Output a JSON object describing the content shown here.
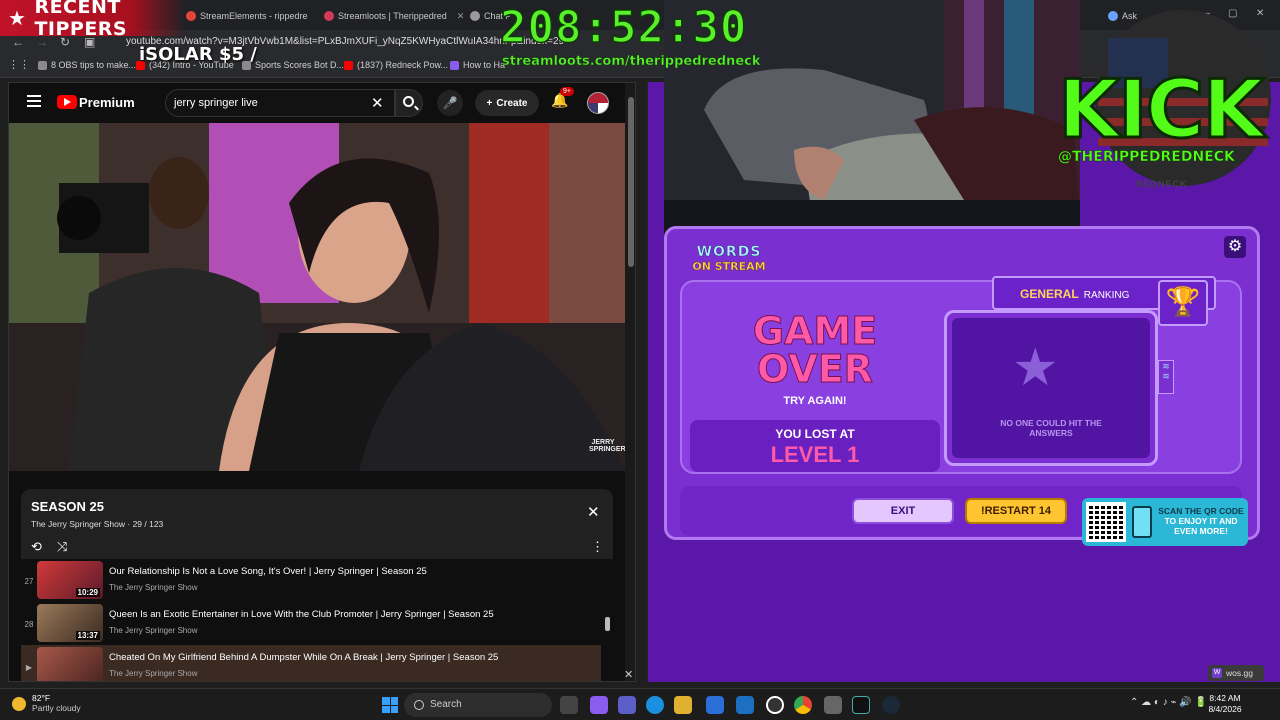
{
  "overlay": {
    "tippers_title": "RECENT TIPPERS",
    "latest_tip": "iSOLAR $5 /",
    "timer": "208:52:30",
    "loots_url": "streamloots.com/therippedredneck",
    "kick_logo": "KICK",
    "kick_handle": "@THERIPPEDREDNECK",
    "kick_sub": "REDNECK"
  },
  "browser": {
    "tabs": [
      {
        "label": "StreamElements - rippedre",
        "color": "#e2463a"
      },
      {
        "label": "Streamloots | Therippedred",
        "color": "#d13a5a"
      },
      {
        "label": "Chat P",
        "color": "#9a9a9a"
      },
      {
        "label": "Ask",
        "color": "#6aa2ff"
      }
    ],
    "url": "youtube.com/watch?v=M3jtVbVwb1M&list=PLxBJmXUFi_yNqZ5KWHyaCtlWuIA34hnFp&index=29",
    "bookmarks": [
      {
        "label": "8 OBS tips to make...",
        "color": "#8a8a8a"
      },
      {
        "label": "(342) Intro - YouTube",
        "color": "#ff0000"
      },
      {
        "label": "Sports Scores Bot D...",
        "color": "#8a8a8a"
      },
      {
        "label": "(1837) Redneck Pow...",
        "color": "#ff0000"
      },
      {
        "label": "How to Ha",
        "color": "#8a5cf0"
      }
    ]
  },
  "youtube": {
    "brand": "Premium",
    "search_value": "jerry springer live",
    "create_label": "Create",
    "notif_count": "9+",
    "watermark": "JERRY SPRINGER",
    "playlist": {
      "title": "SEASON 25",
      "subtitle": "The Jerry Springer Show · 29 / 123",
      "items": [
        {
          "num": "27",
          "title": "Our Relationship Is Not a Love Song, It's Over! | Jerry Springer | Season 25",
          "channel": "The Jerry Springer Show",
          "duration": "10:29",
          "thumb": "#b3292b"
        },
        {
          "num": "28",
          "title": "Queen Is an Exotic Entertainer in Love With the Club Promoter | Jerry Springer | Season 25",
          "channel": "The Jerry Springer Show",
          "duration": "13:37",
          "thumb": "#7a5a40"
        },
        {
          "num": "29",
          "title": "Cheated On My Girlfriend Behind A Dumpster While On A Break | Jerry Springer | Season 25",
          "channel": "The Jerry Springer Show",
          "duration": "",
          "thumb": "#8a4c3c"
        }
      ]
    }
  },
  "game": {
    "logo_top": "WORDS",
    "logo_bottom": "ON STREAM",
    "result_line1": "GAME",
    "result_line2": "OVER",
    "try_again": "TRY AGAIN!",
    "lost_at": "YOU LOST AT",
    "level": "LEVEL 1",
    "ranking_general": "GENERAL",
    "ranking_word": "RANKING",
    "no_answers": "NO ONE COULD HIT THE ANSWERS",
    "exit_label": "EXIT",
    "restart_label": "!RESTART 14",
    "qr_text_dark": "SCAN THE QR CODE",
    "qr_text_light": "TO ENJOY IT AND EVEN MORE!",
    "site": "wos.gg"
  },
  "taskbar": {
    "temp": "82°F",
    "condition": "Partly cloudy",
    "search_placeholder": "Search",
    "time": "8:42 AM",
    "date": "8/4/2026"
  }
}
